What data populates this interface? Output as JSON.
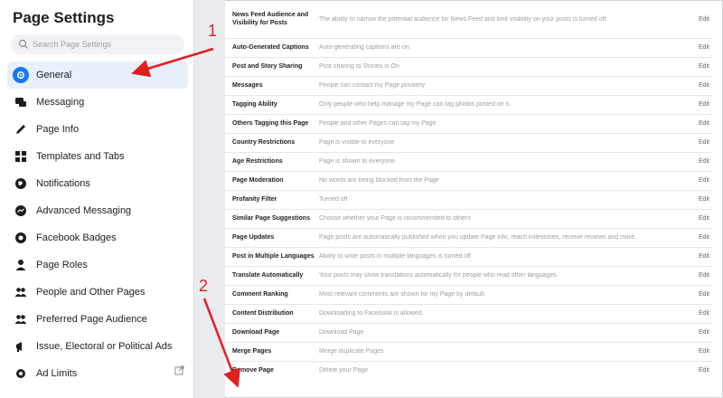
{
  "sidebar": {
    "title": "Page Settings",
    "search_placeholder": "Search Page Settings",
    "items": [
      {
        "label": "General",
        "icon": "gear-icon"
      },
      {
        "label": "Messaging",
        "icon": "chat-icon"
      },
      {
        "label": "Page Info",
        "icon": "pencil-icon"
      },
      {
        "label": "Templates and Tabs",
        "icon": "grid-icon"
      },
      {
        "label": "Notifications",
        "icon": "globe-icon"
      },
      {
        "label": "Advanced Messaging",
        "icon": "messenger-icon"
      },
      {
        "label": "Facebook Badges",
        "icon": "badge-icon"
      },
      {
        "label": "Page Roles",
        "icon": "person-icon"
      },
      {
        "label": "People and Other Pages",
        "icon": "people-icon"
      },
      {
        "label": "Preferred Page Audience",
        "icon": "people-icon"
      },
      {
        "label": "Issue, Electoral or Political Ads",
        "icon": "megaphone-icon"
      },
      {
        "label": "Ad Limits",
        "icon": "settings-icon"
      }
    ]
  },
  "settings": {
    "edit_label": "Edit",
    "rows": [
      {
        "name": "News Feed Audience and Visibility for Posts",
        "desc": "The ability to narrow the potential audience for News Feed and limit visibility on your posts is turned off."
      },
      {
        "name": "Auto-Generated Captions",
        "desc": "Auto-generating captions are on."
      },
      {
        "name": "Post and Story Sharing",
        "desc": "Post sharing to Stories is On"
      },
      {
        "name": "Messages",
        "desc": "People can contact my Page privately"
      },
      {
        "name": "Tagging Ability",
        "desc": "Only people who help manage my Page can tag photos posted on it."
      },
      {
        "name": "Others Tagging this Page",
        "desc": "People and other Pages can tag my Page"
      },
      {
        "name": "Country Restrictions",
        "desc": "Page is visible to everyone"
      },
      {
        "name": "Age Restrictions",
        "desc": "Page is shown to everyone"
      },
      {
        "name": "Page Moderation",
        "desc": "No words are being blocked from the Page"
      },
      {
        "name": "Profanity Filter",
        "desc": "Turned off"
      },
      {
        "name": "Similar Page Suggestions",
        "desc": "Choose whether your Page is recommended to others"
      },
      {
        "name": "Page Updates",
        "desc": "Page posts are automatically published when you update Page info, reach milestones, receive reviews and more."
      },
      {
        "name": "Post in Multiple Languages",
        "desc": "Ability to write posts in multiple languages is turned off"
      },
      {
        "name": "Translate Automatically",
        "desc": "Your posts may show translations automatically for people who read other languages."
      },
      {
        "name": "Comment Ranking",
        "desc": "Most relevant comments are shown for my Page by default."
      },
      {
        "name": "Content Distribution",
        "desc": "Downloading to Facebook is allowed."
      },
      {
        "name": "Download Page",
        "desc": "Download Page"
      },
      {
        "name": "Merge Pages",
        "desc": "Merge duplicate Pages"
      },
      {
        "name": "Remove Page",
        "desc": "Delete your Page"
      }
    ]
  },
  "annotations": {
    "marker_1": "1",
    "marker_2": "2",
    "color": "#e02020"
  },
  "colors": {
    "accent": "#1877f2",
    "active_bg": "#e7f0fb"
  }
}
